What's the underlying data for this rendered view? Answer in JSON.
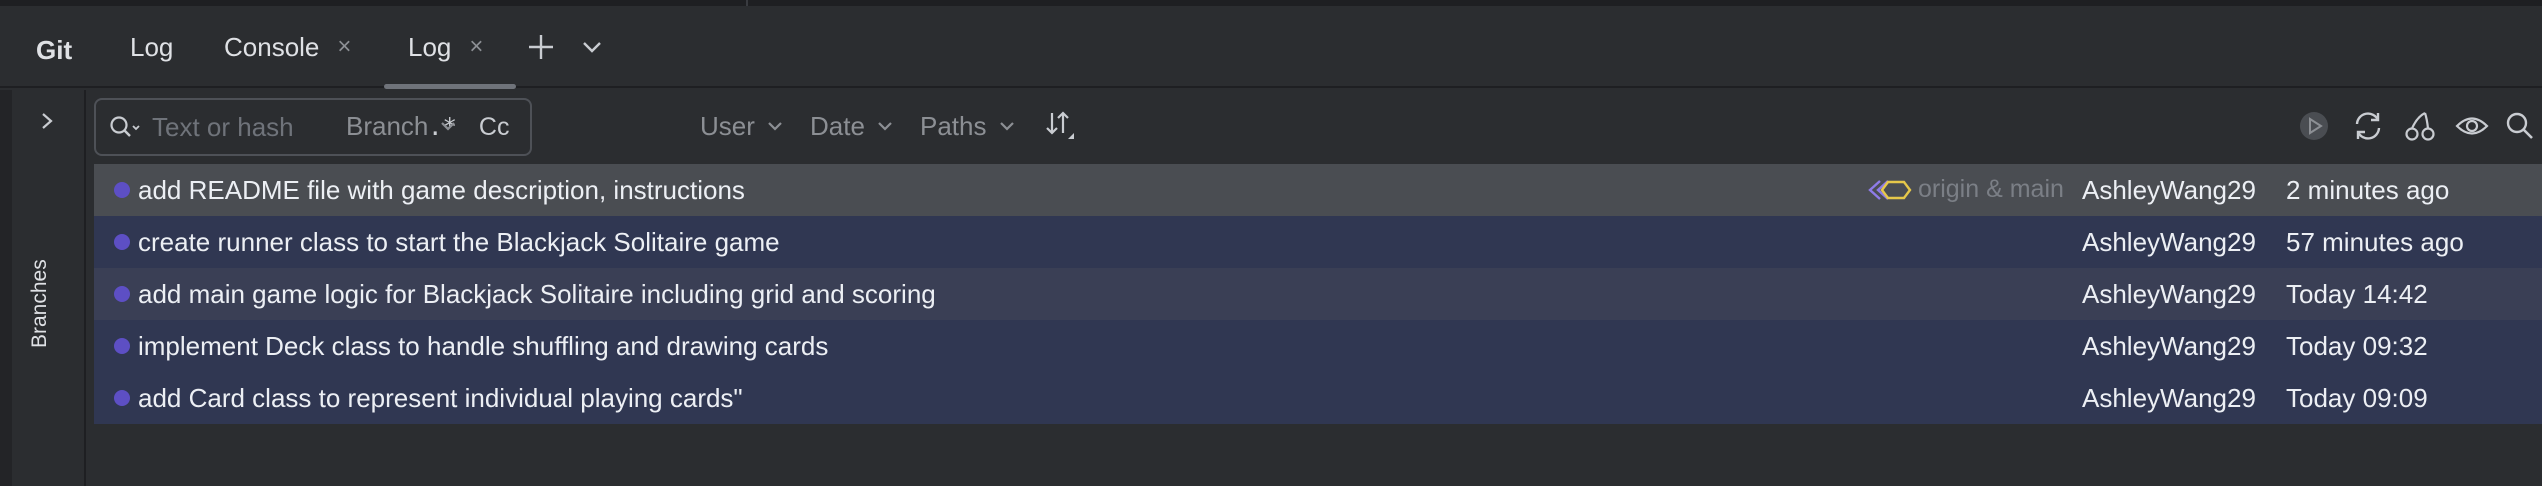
{
  "toolwindow": {
    "title": "Git",
    "tabs": [
      {
        "label": "Log",
        "closable": false
      },
      {
        "label": "Console",
        "closable": true
      },
      {
        "label": "Log",
        "closable": true,
        "active": true
      }
    ],
    "close_glyph": "×",
    "add_icon": "plus-icon",
    "more_icon": "chevron-down-icon"
  },
  "sidebar": {
    "expand_icon": "chevron-right-icon",
    "label": "Branches"
  },
  "filters": {
    "search_placeholder": "Text or hash",
    "regex_label": ".*",
    "case_label": "Cc",
    "branch": "Branch",
    "user": "User",
    "date": "Date",
    "paths": "Paths"
  },
  "commits": [
    {
      "message": "add README file with game description, instructions",
      "refs": "origin & main",
      "author": "AshleyWang29",
      "date": "2 minutes ago",
      "selected": true
    },
    {
      "message": "create runner class to start the Blackjack Solitaire game",
      "refs": "",
      "author": "AshleyWang29",
      "date": "57 minutes ago"
    },
    {
      "message": "add main game logic for Blackjack Solitaire including grid and scoring",
      "refs": "",
      "author": "AshleyWang29",
      "date": "Today 14:42"
    },
    {
      "message": "implement Deck class to handle shuffling and drawing cards",
      "refs": "",
      "author": "AshleyWang29",
      "date": "Today 09:32"
    },
    {
      "message": "add Card class to represent individual playing cards\"",
      "refs": "",
      "author": "AshleyWang29",
      "date": "Today 09:09"
    }
  ],
  "colors": {
    "graph": "#5d4fc4",
    "selected_row": "#4a4d52",
    "row": "#303752",
    "tag_icon_a": "#8e7be8",
    "tag_icon_b": "#e6c84a"
  }
}
